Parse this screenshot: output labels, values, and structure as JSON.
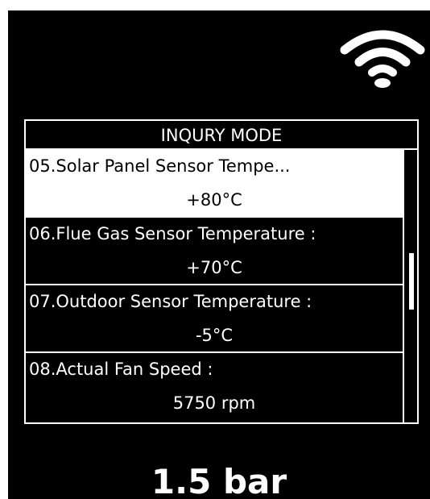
{
  "status": {
    "wifi_icon": "wifi-icon"
  },
  "panel": {
    "title": "INQURY MODE",
    "items": [
      {
        "label": "05.Solar Panel Sensor Tempe...",
        "value": "+80°C",
        "selected": true
      },
      {
        "label": "06.Flue Gas Sensor Temperature :",
        "value": "+70°C",
        "selected": false
      },
      {
        "label": "07.Outdoor Sensor Temperature :",
        "value": "-5°C",
        "selected": false
      },
      {
        "label": "08.Actual Fan Speed :",
        "value": "5750 rpm",
        "selected": false
      }
    ]
  },
  "footer": {
    "pressure": "1.5 bar"
  },
  "colors": {
    "background": "#000000",
    "foreground": "#ffffff"
  }
}
